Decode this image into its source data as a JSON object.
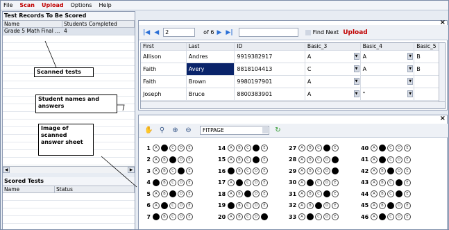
{
  "menu": [
    "File",
    "Scan",
    "Upload",
    "Options",
    "Help"
  ],
  "left": {
    "title_records": "Test Records To Be Scored",
    "records_headers": [
      "Name",
      "Students Completed"
    ],
    "records_rows": [
      {
        "name": "Grade 5 Math Final ...",
        "completed": "4"
      }
    ],
    "title_scored": "Scored Tests",
    "scored_headers": [
      "Name",
      "Status"
    ]
  },
  "callouts": {
    "scanned": "Scanned tests",
    "students": "Student names and answers",
    "image": "Image of scanned answer sheet"
  },
  "nav": {
    "page": "2",
    "of": "of 6",
    "find_next": "Find Next",
    "upload": "Upload"
  },
  "grid": {
    "headers": [
      "First",
      "Last",
      "ID",
      "Basic_3",
      "Basic_4",
      "Basic_5"
    ],
    "rows": [
      [
        "Allison",
        "Andres",
        "9919382917",
        "A",
        "A",
        "B"
      ],
      [
        "Faith",
        "Avery",
        "8818104413",
        "C",
        "A",
        "B"
      ],
      [
        "Faith",
        "Brown",
        "9980197901",
        "A",
        "",
        ""
      ],
      [
        "Joseph",
        "Bruce",
        "8800383901",
        "A",
        "\"",
        ""
      ]
    ]
  },
  "image_toolbar": {
    "zoom_mode": "FITPAGE"
  },
  "sheet": {
    "letters": [
      "A",
      "B",
      "C",
      "D",
      "E"
    ],
    "columns": [
      {
        "start": 1,
        "fills": [
          1,
          2,
          3,
          0,
          2,
          1,
          0
        ]
      },
      {
        "start": 14,
        "fills": [
          3,
          3,
          0,
          1,
          2,
          0,
          4
        ]
      },
      {
        "start": 27,
        "fills": [
          3,
          4,
          4,
          1,
          3,
          2,
          1
        ]
      },
      {
        "start": 40,
        "fills": [
          1,
          1,
          2,
          3,
          3,
          2,
          1
        ]
      }
    ]
  }
}
